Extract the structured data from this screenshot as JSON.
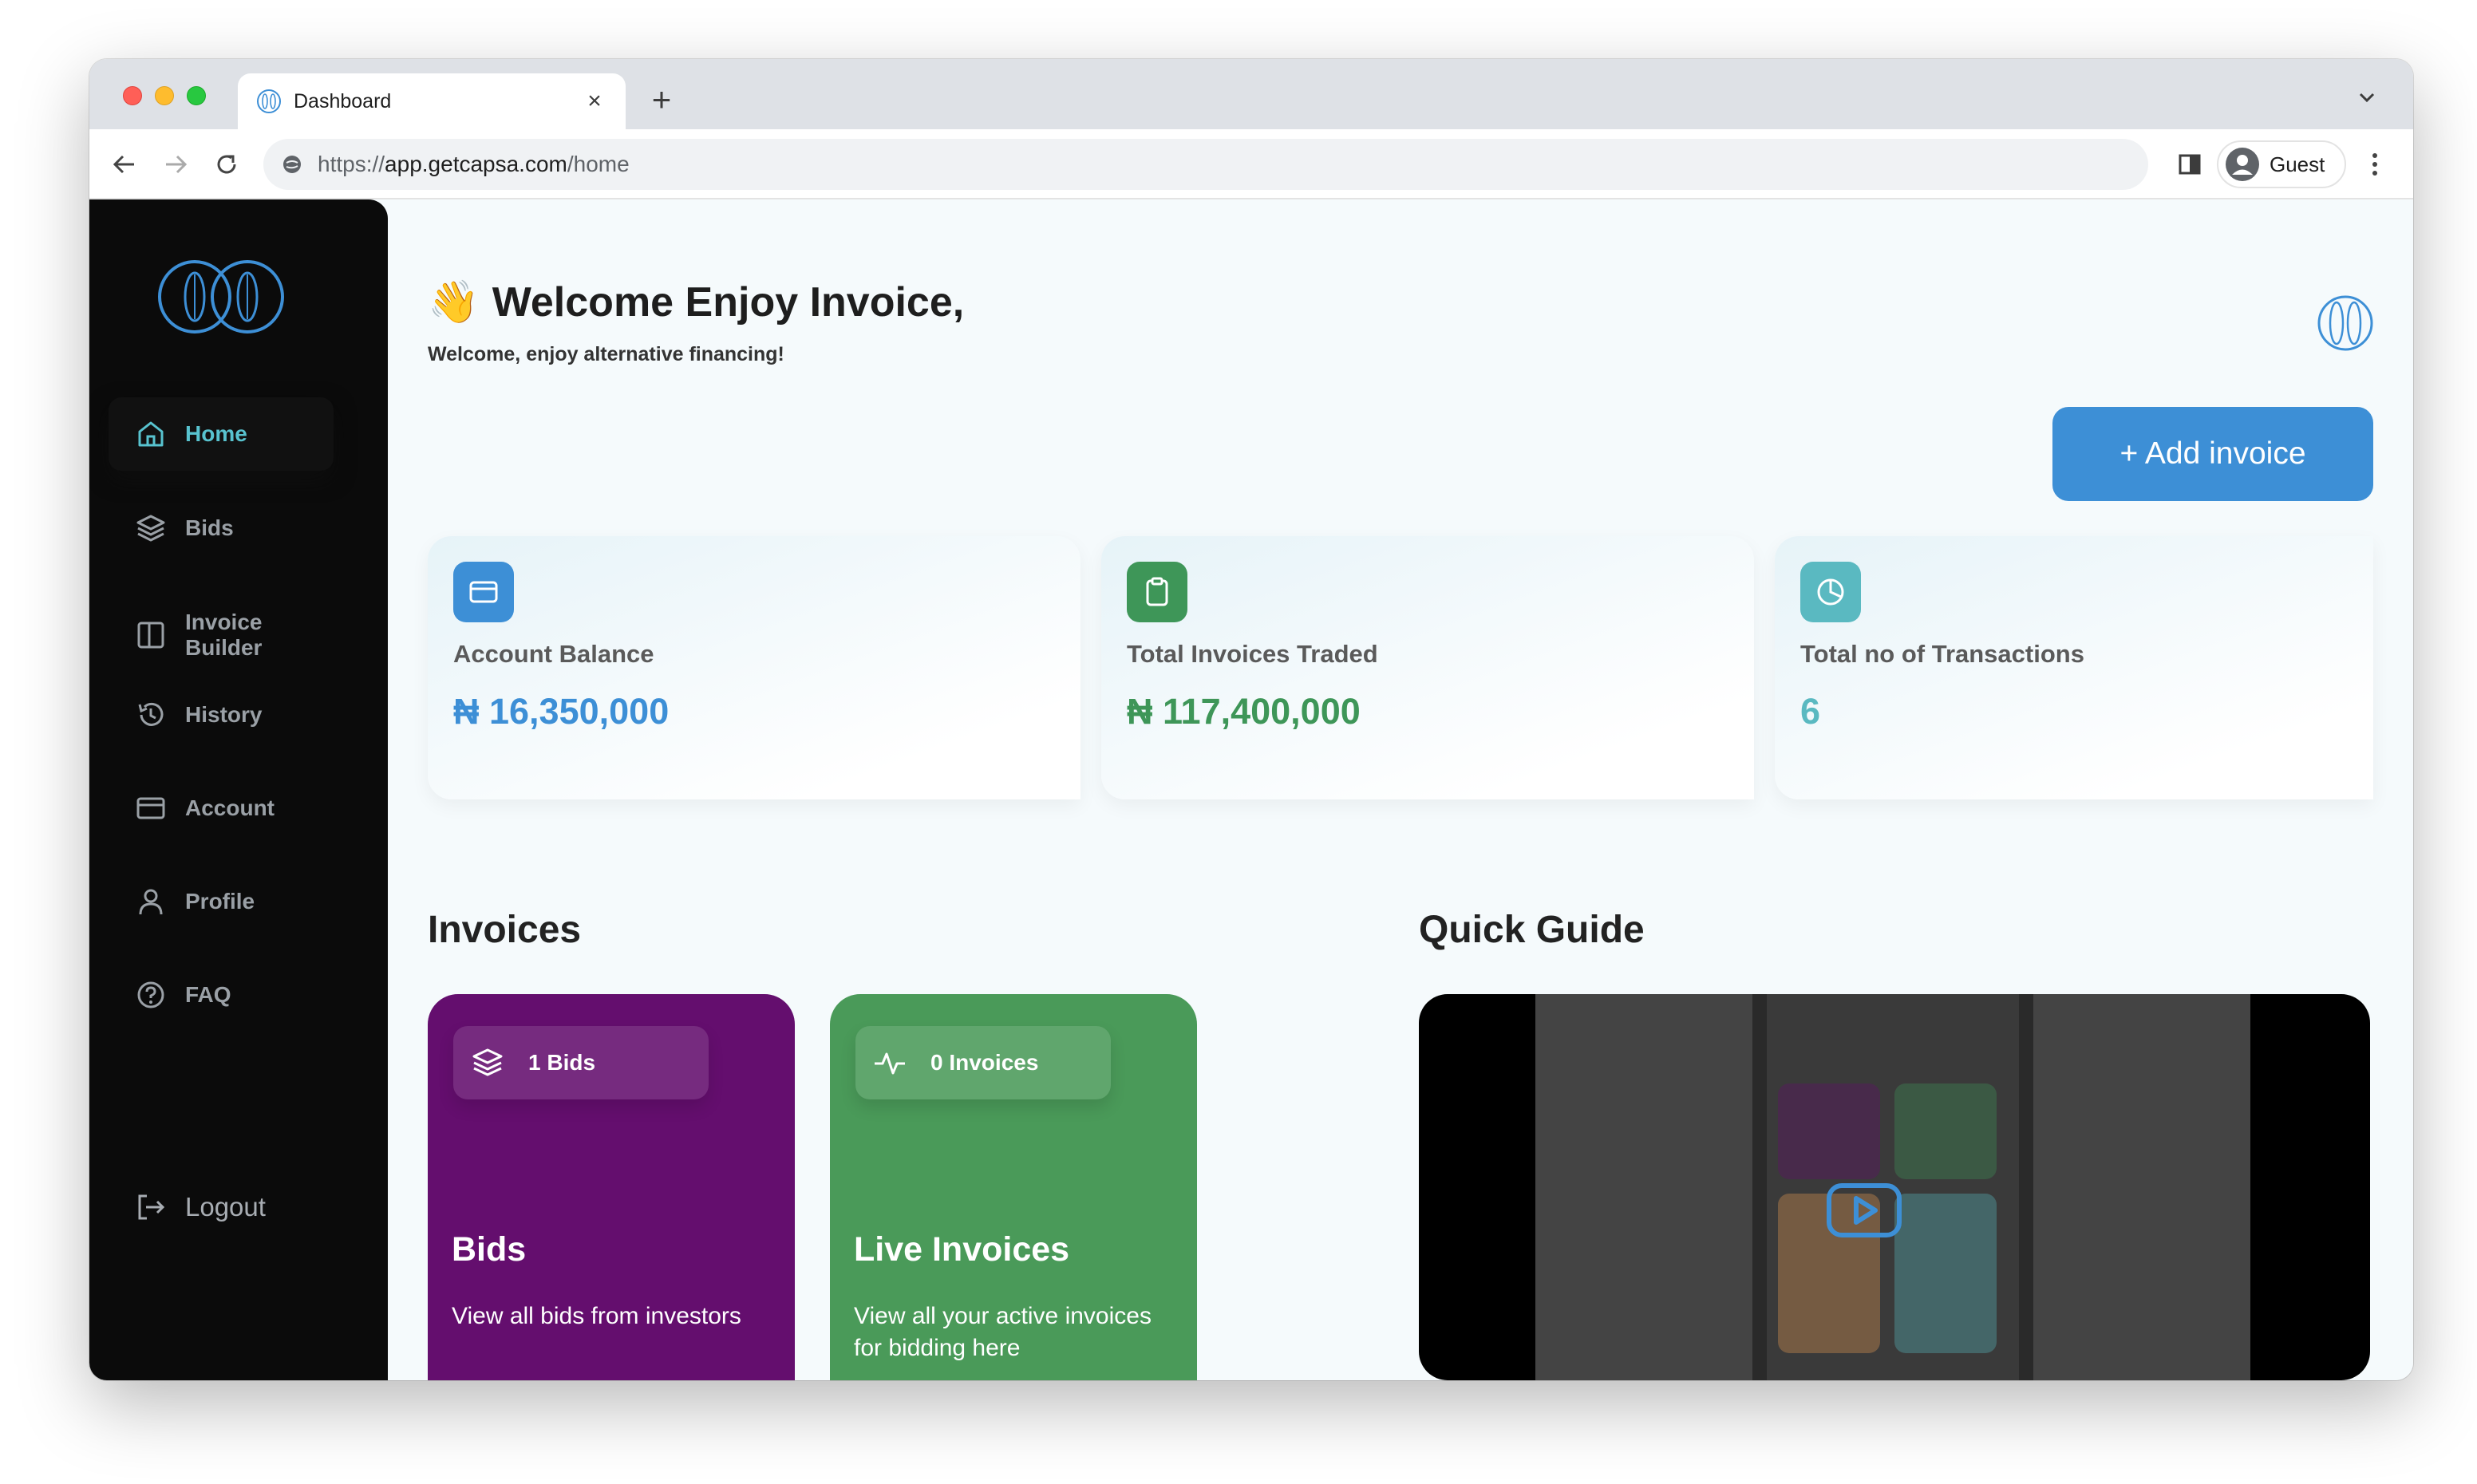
{
  "browser": {
    "tab_title": "Dashboard",
    "tab_close": "×",
    "new_tab": "+",
    "url_scheme": "https://",
    "url_host": "app.getcapsa.com",
    "url_path": "/home",
    "profile_label": "Guest"
  },
  "sidebar": {
    "items": [
      {
        "label": "Home",
        "icon": "home-icon",
        "active": true
      },
      {
        "label": "Bids",
        "icon": "layers-icon"
      },
      {
        "label": "Invoice",
        "label2": "Builder",
        "icon": "columns-icon"
      },
      {
        "label": "History",
        "icon": "history-icon"
      },
      {
        "label": "Account",
        "icon": "card-icon"
      },
      {
        "label": "Profile",
        "icon": "user-icon"
      },
      {
        "label": "FAQ",
        "icon": "help-icon"
      }
    ],
    "logout_label": "Logout"
  },
  "header": {
    "wave": "👋",
    "title": "Welcome Enjoy Invoice,",
    "subtitle": "Welcome, enjoy alternative financing!",
    "add_button": "+  Add invoice"
  },
  "stats": [
    {
      "label": "Account Balance",
      "value": "₦ 16,350,000",
      "color": "#3d8fd6",
      "icon": "card-icon"
    },
    {
      "label": "Total Invoices Traded",
      "value": "₦ 117,400,000",
      "color": "#3e9658",
      "icon": "clipboard-icon"
    },
    {
      "label": "Total no of Transactions",
      "value": "6",
      "color": "#5ab9c1",
      "icon": "pie-chart-icon"
    }
  ],
  "sections": {
    "invoices": "Invoices",
    "quick_guide": "Quick Guide"
  },
  "invoice_cards": [
    {
      "badge": "1 Bids",
      "title": "Bids",
      "description": "View all bids from investors",
      "color": "#640e6e",
      "icon": "layers-icon"
    },
    {
      "badge": "0 Invoices",
      "title": "Live Invoices",
      "description": "View all your active invoices for bidding here",
      "color": "#4a9a59",
      "icon": "activity-icon"
    }
  ],
  "colors": {
    "sidebar_bg": "#0b0b0b",
    "accent_teal": "#58c3cf",
    "accent_blue": "#3d8fd6",
    "peek_orange": "#e59a52",
    "peek_teal": "#5ab9c1"
  }
}
